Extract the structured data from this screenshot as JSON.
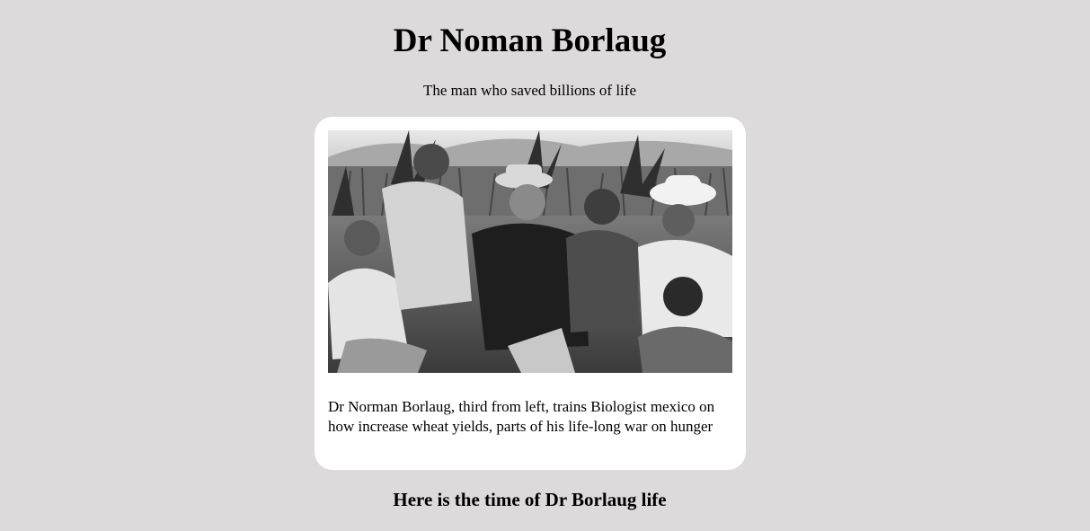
{
  "page": {
    "title": "Dr Noman Borlaug",
    "tagline": "The man who saved billions of life"
  },
  "figure": {
    "image_alt": "Dr Norman Borlaug with biologists in a field in Mexico",
    "caption": "Dr Norman Borlaug, third from left, trains Biologist mexico on how increase wheat yields, parts of his life-long war on hunger"
  },
  "tribute": {
    "heading": "Here is the time of Dr Borlaug life"
  },
  "colors": {
    "background": "#dcdadb",
    "card": "#ffffff"
  }
}
